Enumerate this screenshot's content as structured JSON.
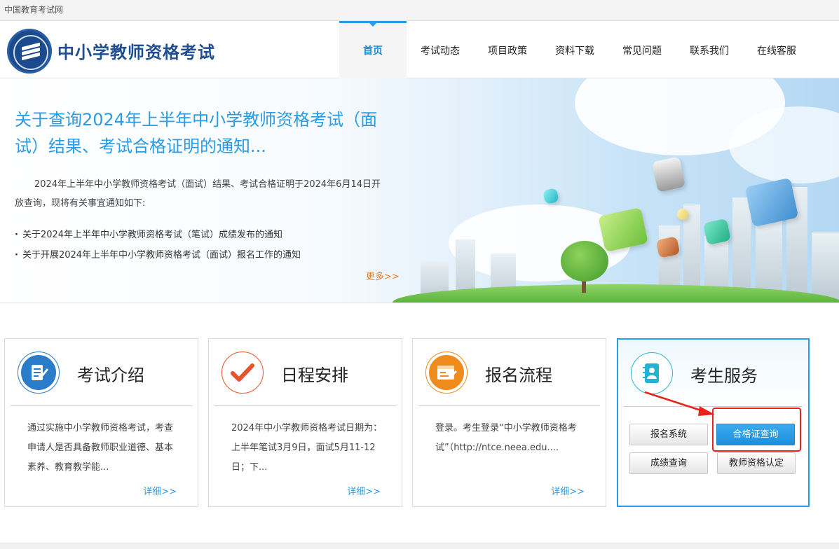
{
  "topbar": {
    "text": "中国教育考试网"
  },
  "header": {
    "title": "中小学教师资格考试",
    "nav": [
      "首页",
      "考试动态",
      "项目政策",
      "资料下载",
      "常见问题",
      "联系我们",
      "在线客服"
    ],
    "active_index": 0
  },
  "banner": {
    "title": "关于查询2024年上半年中小学教师资格考试（面试）结果、考试合格证明的通知...",
    "desc": "2024年上半年中小学教师资格考试（面试）结果、考试合格证明于2024年6月14日开放查询，现将有关事宜通知如下:",
    "links": [
      "关于2024年上半年中小学教师资格考试（笔试）成绩发布的通知",
      "关于开展2024年上半年中小学教师资格考试（面试）报名工作的通知"
    ],
    "more": "更多>>"
  },
  "cards": [
    {
      "title": "考试介绍",
      "text": "通过实施中小学教师资格考试，考查申请人是否具备教师职业道德、基本素养、教育教学能...",
      "more": "详细>>",
      "color": "#2a7bc8"
    },
    {
      "title": "日程安排",
      "text": "2024年中小学教师资格考试日期为：上半年笔试3月9日，面试5月11-12日；下...",
      "more": "详细>>",
      "color": "#e5532a"
    },
    {
      "title": "报名流程",
      "text": "登录。考生登录“中小学教师资格考试”（http://ntce.neea.edu....",
      "more": "详细>>",
      "color": "#ef8a1c"
    }
  ],
  "services": {
    "title": "考生服务",
    "buttons": [
      "报名系统",
      "合格证查询",
      "成绩查询",
      "教师资格认定"
    ],
    "highlight_color": "#e8231c",
    "accent_color": "#2a9be6"
  }
}
